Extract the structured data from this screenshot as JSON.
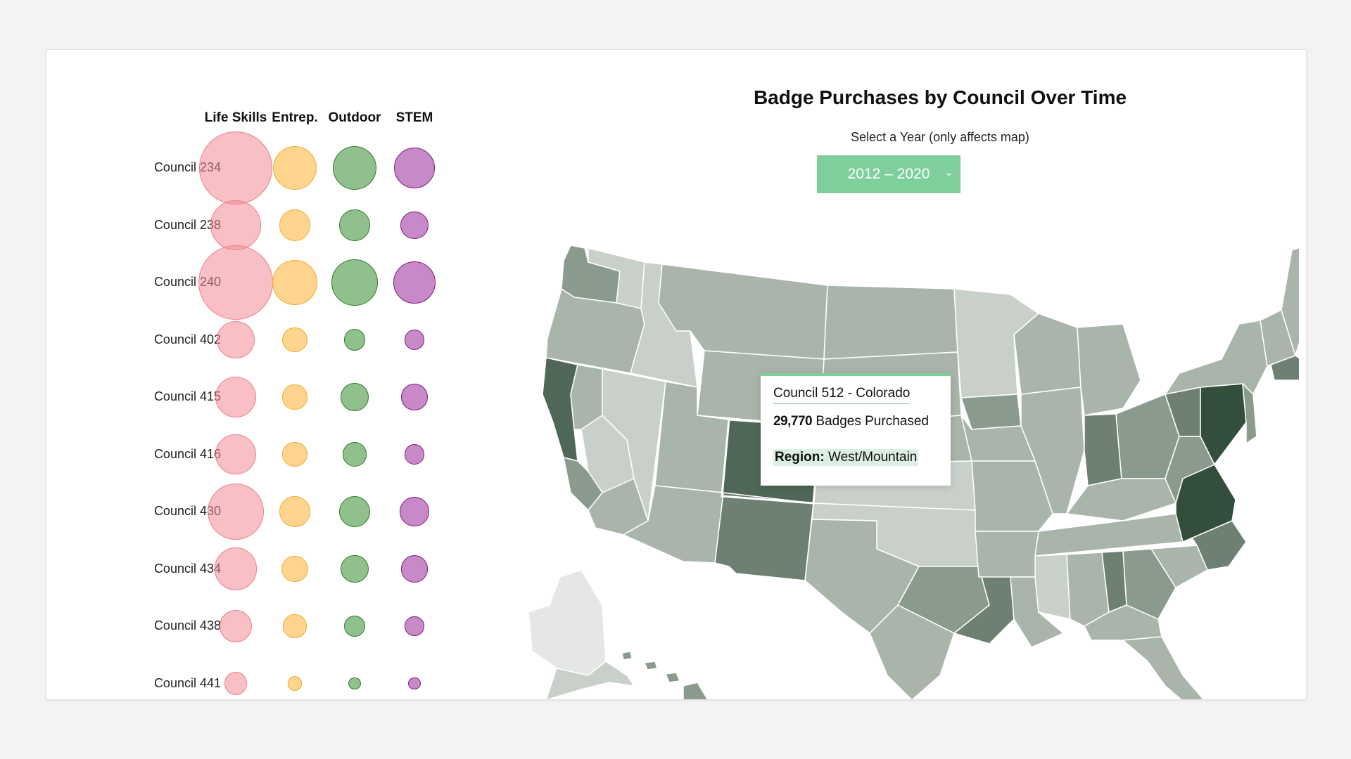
{
  "matrix": {
    "columns": [
      "Life Skills",
      "Entrep.",
      "Outdoor",
      "STEM"
    ],
    "rows": [
      {
        "label": "Council 234",
        "values": [
          1.0,
          0.6,
          0.6,
          0.56
        ]
      },
      {
        "label": "Council 238",
        "values": [
          0.69,
          0.43,
          0.43,
          0.38
        ]
      },
      {
        "label": "Council 240",
        "values": [
          1.02,
          0.62,
          0.63,
          0.58
        ]
      },
      {
        "label": "Council 402",
        "values": [
          0.51,
          0.34,
          0.29,
          0.27
        ]
      },
      {
        "label": "Council 415",
        "values": [
          0.56,
          0.34,
          0.38,
          0.36
        ]
      },
      {
        "label": "Council 416",
        "values": [
          0.55,
          0.34,
          0.33,
          0.27
        ]
      },
      {
        "label": "Council 430",
        "values": [
          0.77,
          0.42,
          0.43,
          0.4
        ]
      },
      {
        "label": "Council 434",
        "values": [
          0.58,
          0.36,
          0.38,
          0.37
        ]
      },
      {
        "label": "Council 438",
        "values": [
          0.45,
          0.32,
          0.29,
          0.26
        ]
      },
      {
        "label": "Council 441",
        "values": [
          0.31,
          0.2,
          0.17,
          0.17
        ]
      }
    ],
    "colors": {
      "Life Skills": "#f28c96",
      "Entrep.": "#ffc464",
      "Outdoor": "#56a04f",
      "STEM": "#a441a4"
    }
  },
  "map": {
    "title": "Badge Purchases by Council Over Time",
    "select_label": "Select a Year (only affects map)",
    "selected_year": "2012 – 2020",
    "accent": "#7fcf9c",
    "shade_scale": [
      "#e4e7e4",
      "#c9d0ca",
      "#a9b5ab",
      "#8a9a8d",
      "#6d8071",
      "#4f6756",
      "#334e3b"
    ]
  },
  "tooltip": {
    "council": "Council 512 - Colorado",
    "count": "29,770",
    "count_suffix": "Badges Purchased",
    "region_label": "Region:",
    "region_value": "West/Mountain"
  }
}
